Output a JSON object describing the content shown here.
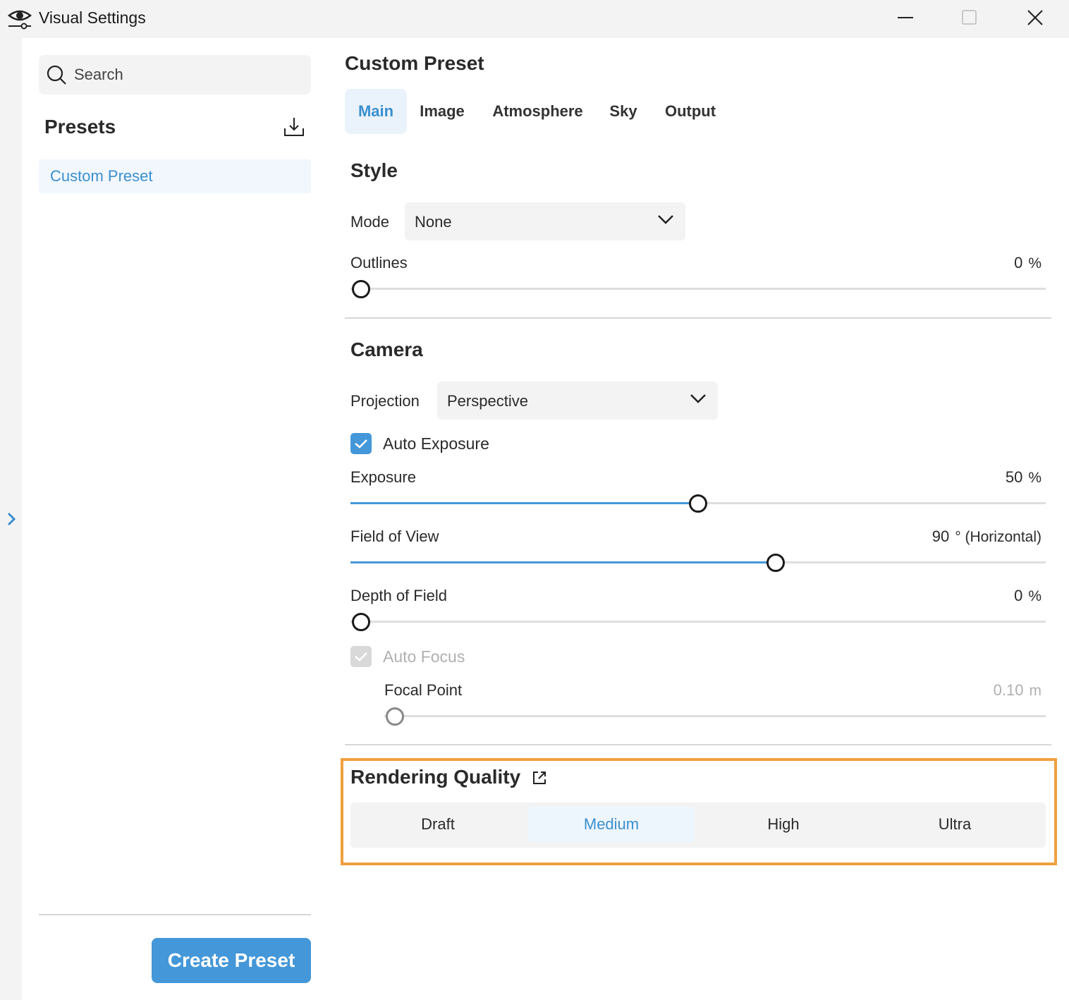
{
  "window": {
    "title": "Visual Settings"
  },
  "sidebar": {
    "search_placeholder": "Search",
    "heading": "Presets",
    "items": [
      {
        "label": "Custom Preset",
        "selected": true
      }
    ],
    "create_button": "Create Preset"
  },
  "main": {
    "title": "Custom Preset",
    "tabs": [
      {
        "label": "Main",
        "active": true
      },
      {
        "label": "Image"
      },
      {
        "label": "Atmosphere"
      },
      {
        "label": "Sky"
      },
      {
        "label": "Output"
      }
    ],
    "style": {
      "heading": "Style",
      "mode_label": "Mode",
      "mode_value": "None",
      "outlines_label": "Outlines",
      "outlines_value": "0",
      "outlines_unit": "%"
    },
    "camera": {
      "heading": "Camera",
      "projection_label": "Projection",
      "projection_value": "Perspective",
      "auto_exposure_label": "Auto Exposure",
      "auto_exposure_checked": true,
      "exposure_label": "Exposure",
      "exposure_value": "50",
      "exposure_unit": "%",
      "exposure_fraction": 0.5,
      "fov_label": "Field of View",
      "fov_value": "90",
      "fov_unit": "° (Horizontal)",
      "fov_fraction": 0.612,
      "dof_label": "Depth of Field",
      "dof_value": "0",
      "dof_unit": "%",
      "auto_focus_label": "Auto Focus",
      "auto_focus_checked": true,
      "auto_focus_disabled": true,
      "focal_point_label": "Focal Point",
      "focal_point_value": "0.10",
      "focal_point_unit": "m"
    },
    "rendering_quality": {
      "heading": "Rendering Quality",
      "options": [
        "Draft",
        "Medium",
        "High",
        "Ultra"
      ],
      "selected": "Medium"
    }
  },
  "colors": {
    "accent": "#4497d8",
    "highlight": "#f0a040"
  }
}
